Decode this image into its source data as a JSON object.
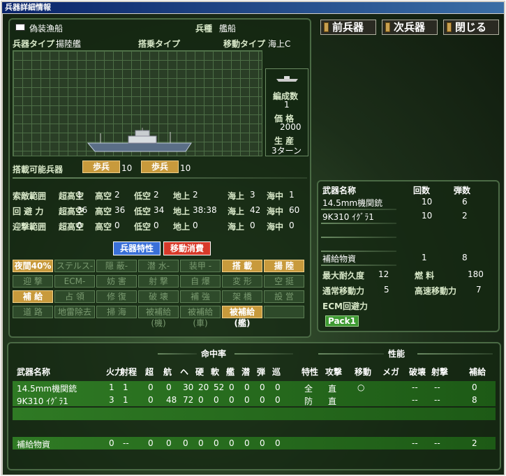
{
  "window": {
    "title": "兵器詳細情報"
  },
  "buttons": {
    "prev": "前兵器",
    "next": "次兵器",
    "close": "閉じる"
  },
  "unit": {
    "name": "偽装漁船",
    "type_label": "兵種",
    "type": "艦船",
    "weapon_type_label": "兵器タイプ",
    "weapon_type": "揚陸艦",
    "ride_label": "搭乗タイプ",
    "ride": "",
    "move_type_label": "移動タイプ",
    "move_type": "海上C",
    "org_label": "編成数",
    "org": "1",
    "price_label": "価 格",
    "price": "2000",
    "prod_label": "生 産",
    "prod": "3ターン"
  },
  "carry": {
    "label": "搭載可能兵器",
    "items": [
      {
        "name": "歩兵",
        "count": "10"
      },
      {
        "name": "歩兵",
        "count": "10"
      }
    ]
  },
  "ranges": {
    "search": {
      "label": "索敵範囲",
      "vals": [
        "超高空",
        "1",
        "高空",
        "2",
        "低空",
        "2",
        "地上",
        "2",
        "海上",
        "3",
        "海中",
        "1"
      ]
    },
    "evade": {
      "label": "回 避 力",
      "vals": [
        "超高空",
        "36",
        "高空",
        "36",
        "低空",
        "34",
        "地上",
        "38:38",
        "海上",
        "42",
        "海中",
        "60"
      ]
    },
    "intercept": {
      "label": "迎撃範囲",
      "vals": [
        "超高空",
        "0",
        "高空",
        "0",
        "低空",
        "0",
        "地上",
        "0",
        "海上",
        "0",
        "海中",
        "0"
      ]
    }
  },
  "tabs": {
    "traits": "兵器特性",
    "move_cost": "移動消費"
  },
  "traits": [
    "夜間40%",
    "ステルス-",
    "隠 蔽-",
    "潜 水-",
    "装甲 -",
    "搭 載",
    "揚 陸",
    "迎 撃",
    "ECM-",
    "妨 害",
    "射 撃",
    "自 爆",
    "変 形",
    "空 挺",
    "補 給",
    "占 領",
    "修 復",
    "破 壊",
    "補 強",
    "架 橋",
    "設 営",
    "道 路",
    "地雷除去",
    "掃 海",
    "被補給(機)",
    "被補給(車)",
    "被補給(艦)",
    ""
  ],
  "weapons_panel": {
    "headers": [
      "武器名称",
      "回数",
      "弾数"
    ],
    "rows": [
      [
        "14.5mm機関銃",
        "10",
        "6"
      ],
      [
        "9K310 ｲｸﾞﾗ1",
        "10",
        "2"
      ],
      [
        "",
        "",
        ""
      ],
      [
        "",
        "",
        ""
      ],
      [
        "補給物資",
        "1",
        "8"
      ]
    ],
    "durability_label": "最大耐久度",
    "durability": "12",
    "fuel_label": "燃 料",
    "fuel": "180",
    "move_label": "通常移動力",
    "move": "5",
    "fast_label": "高速移動力",
    "fast": "7",
    "ecm_label": "ECM回避力",
    "pack": "Pack1"
  },
  "bottom": {
    "group_hit": "命中率",
    "group_perf": "性能",
    "headers": [
      "武器名称",
      "火力",
      "射程",
      "超",
      "航",
      "ヘ",
      "硬",
      "軟",
      "艦",
      "潜",
      "弾",
      "巡",
      "特性",
      "攻撃",
      "移動",
      "メガ",
      "破壊",
      "射撃",
      "補給"
    ],
    "rows": [
      [
        "14.5mm機関銃",
        "1",
        "1",
        "0",
        "0",
        "30",
        "20",
        "52",
        "0",
        "0",
        "0",
        "0",
        "全",
        "直",
        "○",
        "",
        "--",
        "--",
        "0"
      ],
      [
        "9K310 ｲｸﾞﾗ1",
        "3",
        "1",
        "0",
        "48",
        "72",
        "0",
        "0",
        "0",
        "0",
        "0",
        "0",
        "防",
        "直",
        "",
        "",
        "--",
        "--",
        "8"
      ],
      [
        "",
        "",
        "",
        "",
        "",
        "",
        "",
        "",
        "",
        "",
        "",
        "",
        "",
        "",
        "",
        "",
        "",
        "",
        ""
      ],
      [
        "補給物資",
        "0",
        "--",
        "0",
        "0",
        "0",
        "0",
        "0",
        "0",
        "0",
        "0",
        "0",
        "",
        "",
        "",
        "",
        "--",
        "--",
        "2"
      ]
    ]
  }
}
